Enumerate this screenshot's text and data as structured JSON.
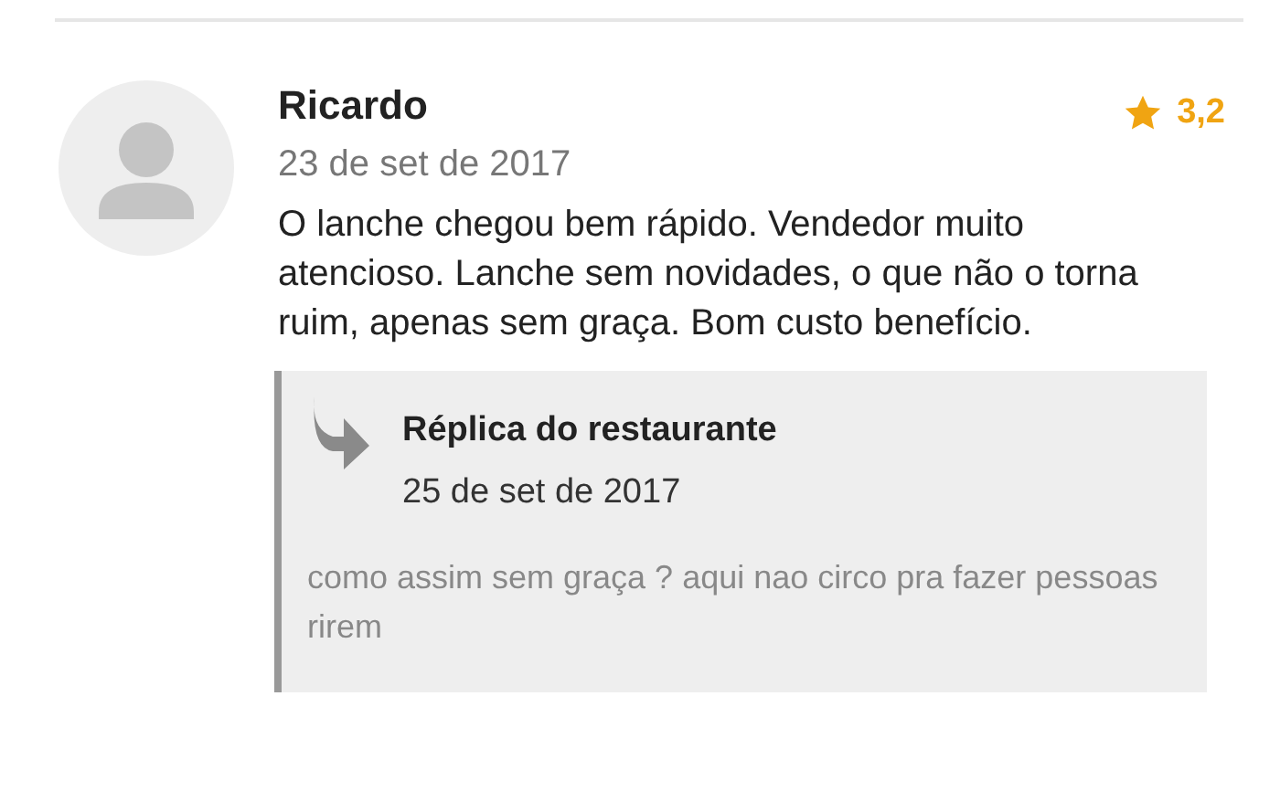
{
  "review": {
    "author": "Ricardo",
    "date": "23 de set de 2017",
    "rating": "3,2",
    "text": "O lanche chegou bem rápido. Vendedor muito atencioso. Lanche sem novidades, o que não o torna ruim, apenas sem graça. Bom custo benefício."
  },
  "reply": {
    "title": "Réplica do restaurante",
    "date": "25 de set de 2017",
    "text": "como assim sem graça ? aqui nao circo pra fazer pessoas rirem"
  }
}
